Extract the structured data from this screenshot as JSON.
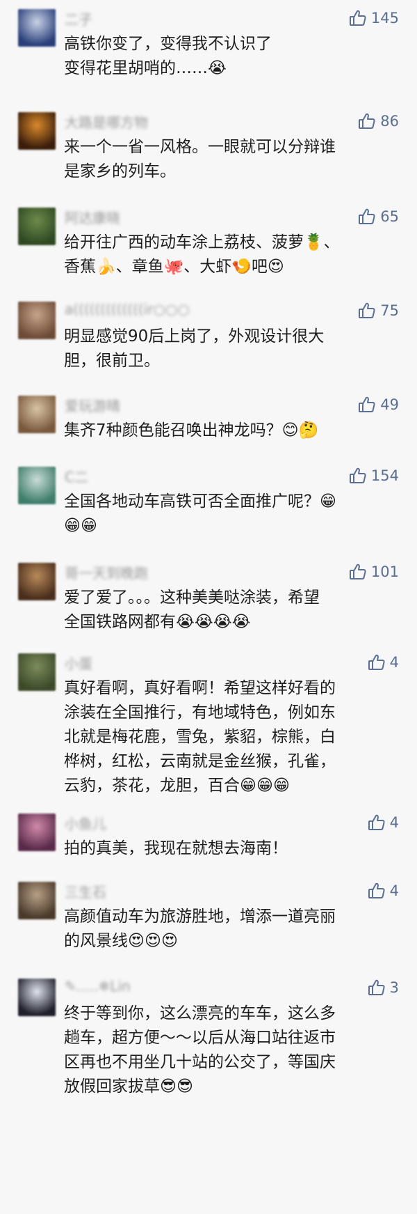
{
  "comments": [
    {
      "name": "二子",
      "likes": "145",
      "lines": [
        "高铁你变了，变得我不认识了",
        "变得花里胡哨的……😭"
      ],
      "avatar_colors": [
        "#2a3f7a",
        "#c9d3e6"
      ]
    },
    {
      "name": "大路是哪方物",
      "likes": "86",
      "lines": [
        "来一个一省一风格。一眼就可以分辩谁",
        "是家乡的列车。"
      ],
      "avatar_colors": [
        "#3a1d0a",
        "#d9892b"
      ]
    },
    {
      "name": "阿达康晓",
      "likes": "65",
      "lines": [
        "给开往广西的动车涂上荔枝、菠萝🍍、",
        "香蕉🍌、章鱼🐙、大虾🍤吧😍"
      ],
      "avatar_colors": [
        "#2f4a22",
        "#6e8a4c"
      ]
    },
    {
      "name": "a(((((((((((((ir○○○",
      "likes": "75",
      "lines": [
        "明显感觉90后上岗了，外观设计很大",
        "胆，很前卫。"
      ],
      "avatar_colors": [
        "#6d4b37",
        "#c7a48a"
      ]
    },
    {
      "name": "爱玩游晴",
      "likes": "49",
      "lines": [
        "集齐7种颜色能召唤出神龙吗？😊🤔"
      ],
      "avatar_colors": [
        "#7a5a3e",
        "#d8c3a5"
      ]
    },
    {
      "name": "C二",
      "likes": "154",
      "lines": [
        "全国各地动车高铁可否全面推广呢？😁",
        "😁😁"
      ],
      "avatar_colors": [
        "#3f7d6a",
        "#c8dcd6"
      ]
    },
    {
      "name": "哥一天到晚跑",
      "likes": "101",
      "lines": [
        "爱了爱了。。。这种美美哒涂装，希望",
        "全国铁路网都有😭😭😭😭"
      ],
      "avatar_colors": [
        "#4a2e1c",
        "#b88a5a"
      ]
    },
    {
      "name": "小蛋",
      "likes": "4",
      "lines": [
        "真好看啊，真好看啊！希望这样好看的",
        "涂装在全国推行，有地域特色，例如东",
        "北就是梅花鹿，雪兔，紫貂，棕熊，白",
        "桦树，红松，云南就是金丝猴，孔雀，",
        "云豹，茶花，龙胆，百合😁😁😁"
      ],
      "avatar_colors": [
        "#3c4a2a",
        "#7c8c5a"
      ]
    },
    {
      "name": "小鱼儿",
      "likes": "4",
      "lines": [
        "拍的真美，我现在就想去海南！"
      ],
      "avatar_colors": [
        "#5a2a4a",
        "#d08aa8"
      ]
    },
    {
      "name": "三生石",
      "likes": "4",
      "lines": [
        "高颜值动车为旅游胜地，增添一道亮丽",
        "的风景线😍😍😍"
      ],
      "avatar_colors": [
        "#4a3a2a",
        "#b8a088"
      ]
    },
    {
      "name": "✎.....❄Lin",
      "likes": "3",
      "lines": [
        "终于等到你，这么漂亮的车车，这么多",
        "趟车，超方便～～以后从海口站往返市",
        "区再也不用坐几十站的公交了，等国庆",
        "放假回家拔草😎😎"
      ],
      "avatar_colors": [
        "#1f1f2a",
        "#dfe4ee"
      ]
    }
  ]
}
